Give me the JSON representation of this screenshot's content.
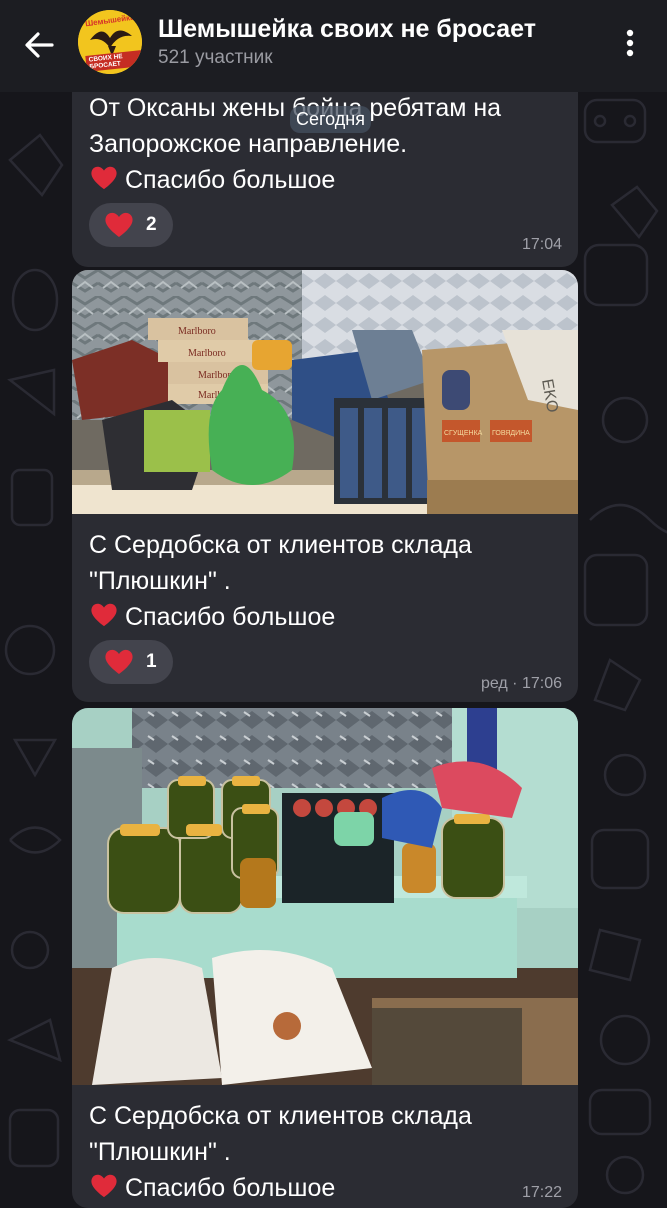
{
  "header": {
    "title": "Шемышейка своих не бросает",
    "subtitle": "521 участник",
    "avatar": {
      "top_text": "Шемышейка",
      "bottom_text": "СВОИХ НЕ БРОСАЕТ"
    }
  },
  "date_separator": "Сегодня",
  "messages": [
    {
      "lines": [
        "От Оксаны жены бойца ребятам на",
        "Запорожское направление."
      ],
      "thanks": "Спасибо большое",
      "reaction": {
        "emoji": "heart",
        "count": "2"
      },
      "time": "17:04"
    },
    {
      "lines": [
        "С Сердобска от  клиентов склада",
        "\"Плюшкин\" ."
      ],
      "thanks": "Спасибо большое",
      "reaction": {
        "emoji": "heart",
        "count": "1"
      },
      "time": "ред · 17:06"
    },
    {
      "lines": [
        "С Сердобска от  клиентов склада",
        "\"Плюшкин\" ."
      ],
      "thanks": "Спасибо большое",
      "time": "17:22"
    }
  ],
  "photo_packs": [
    "Marlboro",
    "Marlboro",
    "Marlboro",
    "Marlboro"
  ],
  "photo_box": "EKO",
  "photo_cans": [
    "СГУЩЕНКА",
    "ГОВЯДИНА"
  ],
  "colors": {
    "background": "#16161b",
    "bubble": "#2b2c33",
    "header": "#1c1d22",
    "heart": "#e02b3a"
  },
  "icons": [
    "back-arrow-icon",
    "more-vertical-icon",
    "heart-icon"
  ]
}
